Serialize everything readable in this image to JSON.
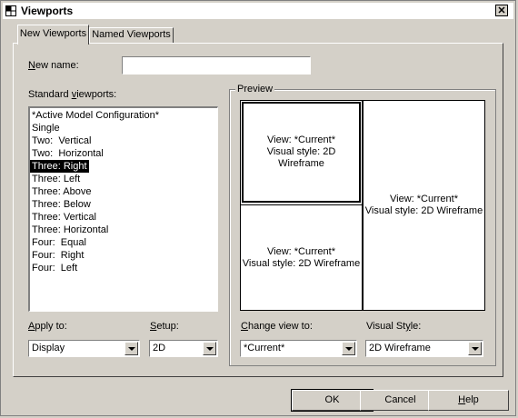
{
  "window": {
    "title": "Viewports",
    "close_glyph": "✕"
  },
  "tabs": [
    {
      "label": "New Viewports",
      "active": true
    },
    {
      "label": "Named Viewports",
      "active": false
    }
  ],
  "new_name": {
    "label_prefix": "N",
    "label_rest": "ew name:",
    "value": ""
  },
  "standard_viewports": {
    "label_prefix": "Standard ",
    "label_accel": "v",
    "label_rest": "iewports:",
    "items": [
      "*Active Model Configuration*",
      "Single",
      "Two:  Vertical",
      "Two:  Horizontal",
      "Three: Right",
      "Three: Left",
      "Three: Above",
      "Three: Below",
      "Three: Vertical",
      "Three: Horizontal",
      "Four:  Equal",
      "Four:  Right",
      "Four:  Left"
    ],
    "selected_index": 4
  },
  "preview": {
    "title": "Preview",
    "viewports": [
      {
        "view": "View: *Current*",
        "style": "Visual style: 2D Wireframe"
      },
      {
        "view": "View: *Current*",
        "style": "Visual style: 2D Wireframe"
      },
      {
        "view": "View: *Current*",
        "style": "Visual style: 2D Wireframe"
      }
    ]
  },
  "apply_to": {
    "label_accel": "A",
    "label_rest": "pply to:",
    "value": "Display"
  },
  "setup": {
    "label_accel": "S",
    "label_rest": "etup:",
    "value": "2D"
  },
  "change_view": {
    "label_accel": "C",
    "label_rest": "hange view to:",
    "value": "*Current*"
  },
  "visual_style": {
    "label_prefix": "Visual St",
    "label_accel": "y",
    "label_rest": "le:",
    "value": "2D Wireframe"
  },
  "buttons": {
    "ok": "OK",
    "cancel": "Cancel",
    "help_accel": "H",
    "help_rest": "elp"
  },
  "colors": {
    "face": "#d4d0c8",
    "selection": "#000000",
    "field": "#ffffff"
  }
}
